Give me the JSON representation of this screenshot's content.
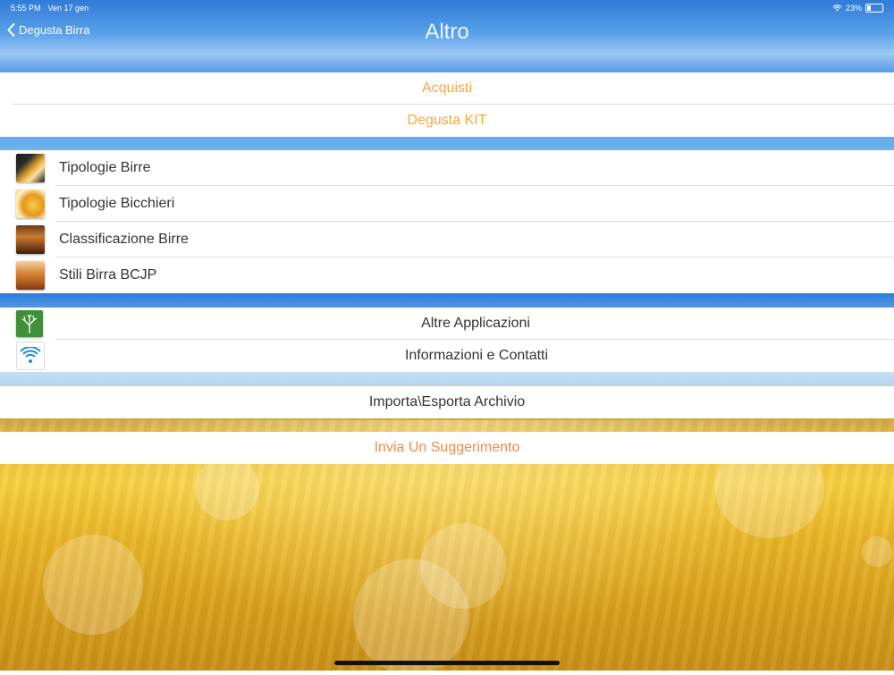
{
  "status_bar": {
    "time": "5:55 PM",
    "date": "Ven 17 gen",
    "battery": "23%"
  },
  "nav": {
    "back_label": "Degusta Birra",
    "title": "Altro"
  },
  "section_purchase": {
    "items": [
      {
        "label": "Acquisti"
      },
      {
        "label": "Degusta KIT"
      }
    ]
  },
  "section_guides": {
    "items": [
      {
        "label": "Tipologie Birre",
        "icon": "beer-glasses-icon"
      },
      {
        "label": "Tipologie Bicchieri",
        "icon": "beer-glass-icon"
      },
      {
        "label": "Classificazione Birre",
        "icon": "beer-bottles-icon"
      },
      {
        "label": "Stili Birra BCJP",
        "icon": "beer-mug-icon"
      }
    ]
  },
  "section_info": {
    "items": [
      {
        "label": "Altre Applicazioni",
        "icon": "tree-icon"
      },
      {
        "label": "Informazioni e Contatti",
        "icon": "wifi-icon"
      }
    ]
  },
  "section_archive": {
    "label": "Importa\\Esporta Archivio"
  },
  "section_feedback": {
    "label": "Invia Un Suggerimento"
  },
  "colors": {
    "accent": "#f5a93a",
    "suggestion": "#f0894a",
    "text": "#333333"
  }
}
